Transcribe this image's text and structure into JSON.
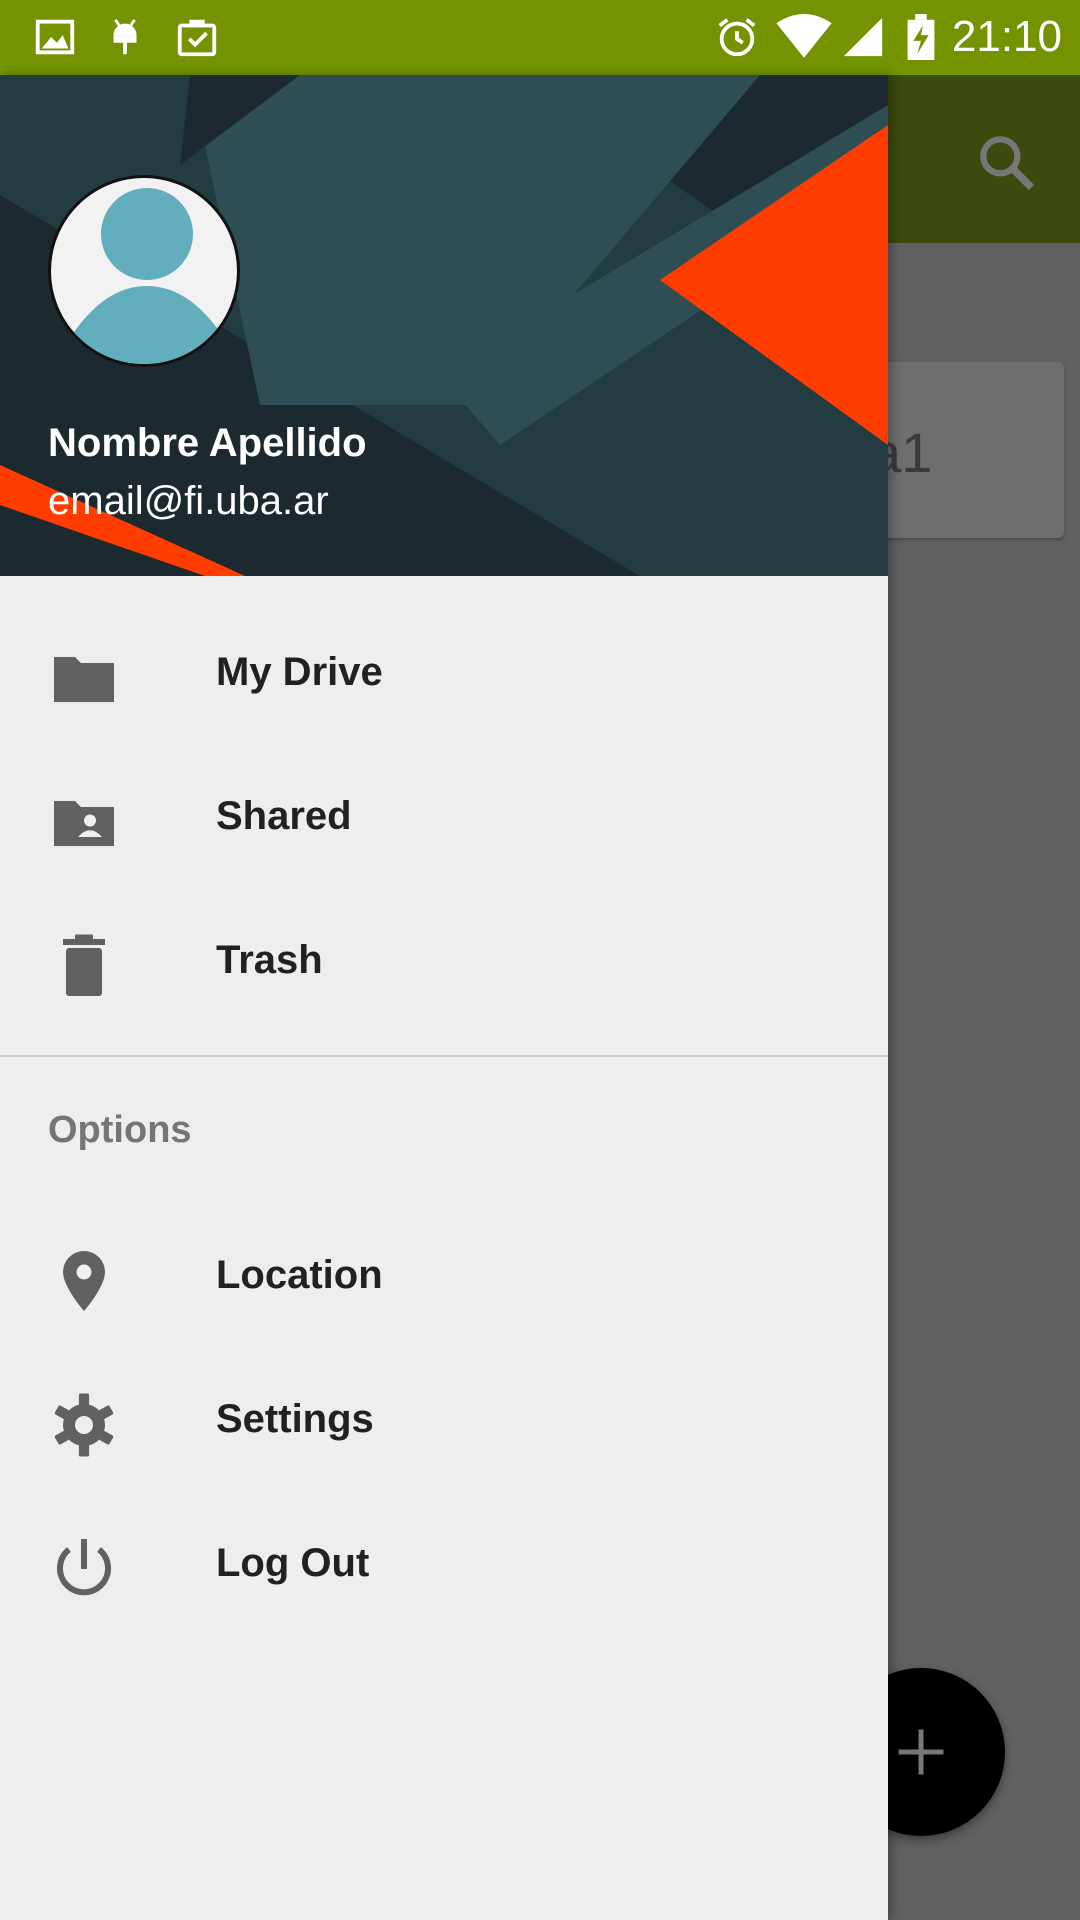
{
  "status_bar": {
    "time": "21:10",
    "left_icons": [
      "image-icon",
      "android-icon",
      "clipboard-check-icon"
    ],
    "right_icons": [
      "alarm-icon",
      "wifi-icon",
      "signal-icon",
      "battery-charging-icon"
    ],
    "background": "#739400"
  },
  "app": {
    "toolbar_color": "#3d4a0d",
    "card_label_fragment": "a1",
    "fab_icon": "plus-icon"
  },
  "drawer": {
    "header": {
      "name": "Nombre Apellido",
      "email": "email@fi.uba.ar"
    },
    "primary_items": [
      {
        "label": "My Drive",
        "icon": "folder-icon"
      },
      {
        "label": "Shared",
        "icon": "shared-folder-icon"
      },
      {
        "label": "Trash",
        "icon": "trash-icon"
      }
    ],
    "section_title": "Options",
    "option_items": [
      {
        "label": "Location",
        "icon": "location-pin-icon"
      },
      {
        "label": "Settings",
        "icon": "gear-icon"
      },
      {
        "label": "Log Out",
        "icon": "power-icon"
      }
    ],
    "accent_color": "#ff3d00"
  }
}
